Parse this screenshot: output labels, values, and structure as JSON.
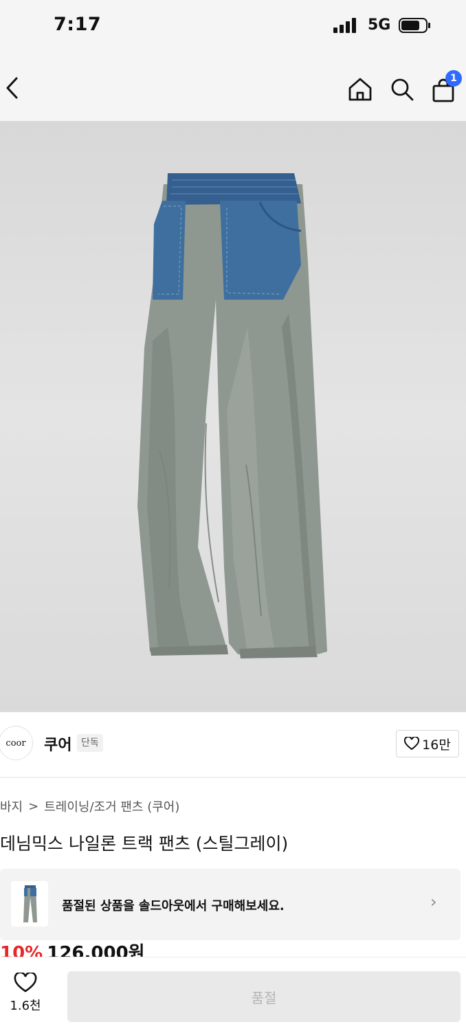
{
  "status_bar": {
    "time": "7:17",
    "network": "5G"
  },
  "nav": {
    "cart_badge": "1"
  },
  "brand": {
    "logo_text": "coor",
    "name": "쿠어",
    "tag": "단독",
    "likes": "16만"
  },
  "breadcrumb": {
    "category": "바지",
    "separator": ">",
    "subcategory": "트레이닝/조거 팬츠 (쿠어)"
  },
  "product": {
    "title": "데님믹스 나일론 트랙 팬츠 (스틸그레이)"
  },
  "soldout_banner": {
    "text": "품절된 상품을 솔드아웃에서 구매해보세요."
  },
  "price": {
    "discount": "10%",
    "amount": "126,000원"
  },
  "bottom_bar": {
    "wish_count": "1.6천",
    "buy_label": "품절"
  },
  "colors": {
    "accent_blue": "#2f6bff",
    "discount_red": "#e5282b",
    "denim": "#3e6f9e",
    "nylon": "#8f9890"
  }
}
